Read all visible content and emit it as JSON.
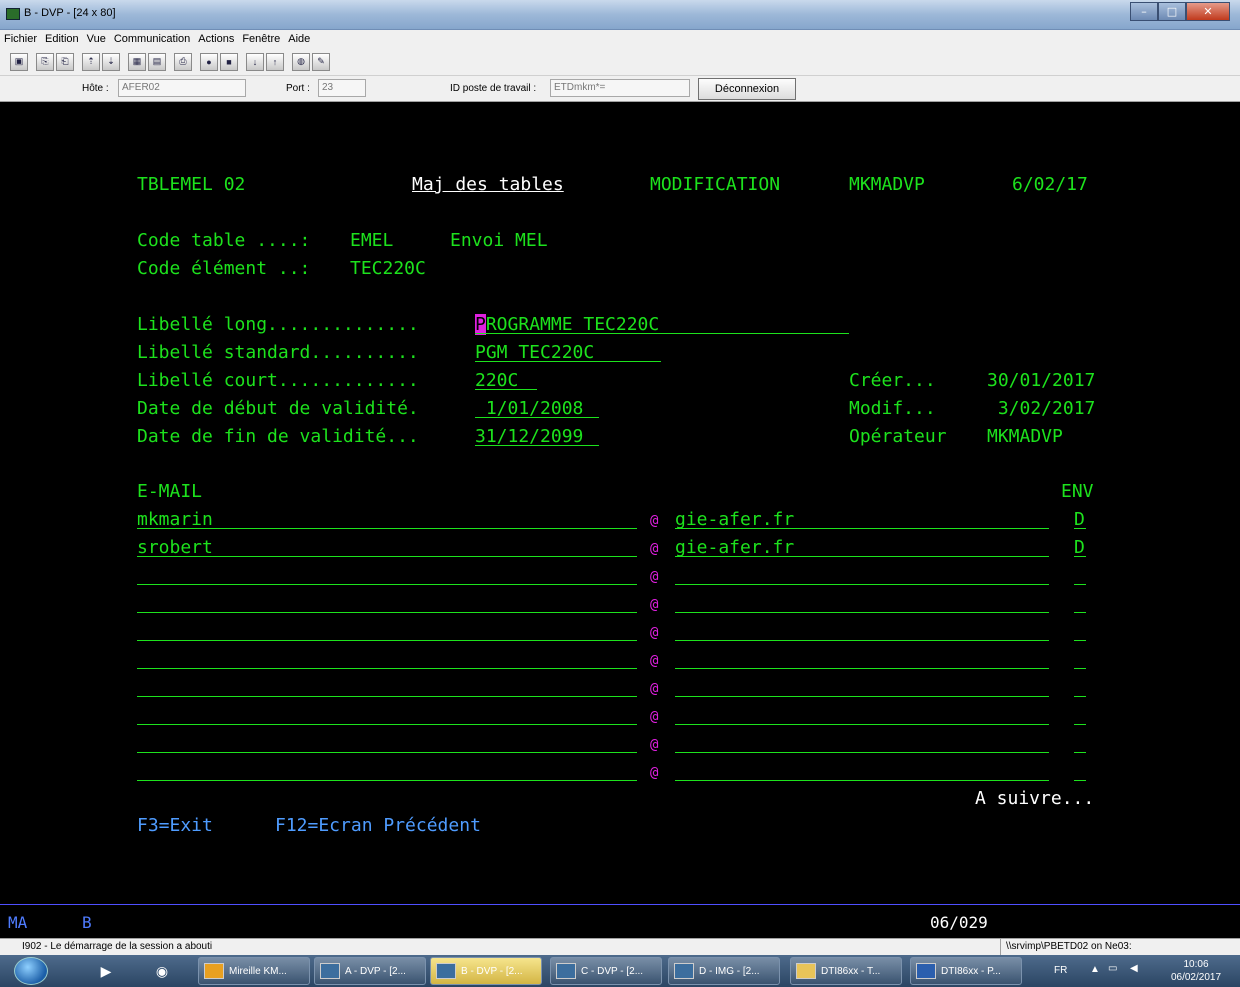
{
  "window": {
    "title": "B - DVP - [24 x 80]",
    "buttons": [
      "–",
      "□",
      "✕"
    ]
  },
  "menu": [
    "Fichier",
    "Edition",
    "Vue",
    "Communication",
    "Actions",
    "Fenêtre",
    "Aide"
  ],
  "toolbar_icons": [
    "display-icon",
    "copy-icon",
    "paste-icon",
    "send-icon",
    "receive-icon",
    "macro-icon",
    "play-icon",
    "print-icon",
    "record-icon",
    "stop-icon",
    "download-icon",
    "upload-icon",
    "globe-icon",
    "pencil-icon"
  ],
  "hostbar": {
    "host_label": "Hôte :",
    "host_value": "AFER02",
    "port_label": "Port :",
    "port_value": "23",
    "workstation_label": "ID poste de travail :",
    "workstation_value": "ETDmkm*=",
    "disconnect": "Déconnexion"
  },
  "screen": {
    "program": "TBLEMEL 02",
    "title": "Maj des tables",
    "mode": "MODIFICATION",
    "user": "MKMADVP",
    "date": "6/02/17",
    "code_table_label": "Code table ....:",
    "code_table": "EMEL",
    "code_table_desc": "Envoi MEL",
    "code_element_label": "Code élément ..:",
    "code_element": "TEC220C",
    "fields": [
      {
        "label": "Libellé long..............",
        "value": "PROGRAMME TEC220C"
      },
      {
        "label": "Libellé standard..........",
        "value": "PGM TEC220C"
      },
      {
        "label": "Libellé court.............",
        "value": "220C"
      },
      {
        "label": "Date de début de validité.",
        "value": " 1/01/2008"
      },
      {
        "label": "Date de fin de validité...",
        "value": "31/12/2099"
      }
    ],
    "cursor_char": "P",
    "long_rest": "ROGRAMME TEC220C",
    "right_info": [
      {
        "label": "Créer...",
        "value": "30/01/2017"
      },
      {
        "label": "Modif...",
        "value": " 3/02/2017"
      },
      {
        "label": "Opérateur",
        "value": "MKMADVP"
      }
    ],
    "email_header": "E-MAIL",
    "env_header": "ENV",
    "at": "@",
    "emails": [
      {
        "user": "mkmarin",
        "domain": "gie-afer.fr",
        "env": "D"
      },
      {
        "user": "srobert",
        "domain": "gie-afer.fr",
        "env": "D"
      },
      {
        "user": "",
        "domain": "",
        "env": ""
      },
      {
        "user": "",
        "domain": "",
        "env": ""
      },
      {
        "user": "",
        "domain": "",
        "env": ""
      },
      {
        "user": "",
        "domain": "",
        "env": ""
      },
      {
        "user": "",
        "domain": "",
        "env": ""
      },
      {
        "user": "",
        "domain": "",
        "env": ""
      },
      {
        "user": "",
        "domain": "",
        "env": ""
      },
      {
        "user": "",
        "domain": "",
        "env": ""
      }
    ],
    "more": "A suivre...",
    "f3": "F3=Exit",
    "f12": "F12=Ecran Précédent"
  },
  "status": {
    "ma": "MA",
    "b": "B",
    "position": "06/029"
  },
  "message": {
    "text": "I902 - Le démarrage de la session a abouti",
    "server": "\\\\srvimp\\PBETD02 on Ne03:"
  },
  "taskbar": {
    "tasks": [
      "Mireille KM...",
      "A - DVP - [2...",
      "B - DVP - [2...",
      "C - DVP - [2...",
      "D - IMG - [2...",
      "DTI86xx - T...",
      "DTI86xx - P..."
    ],
    "lang": "FR",
    "time": "10:06",
    "date": "06/02/2017"
  }
}
